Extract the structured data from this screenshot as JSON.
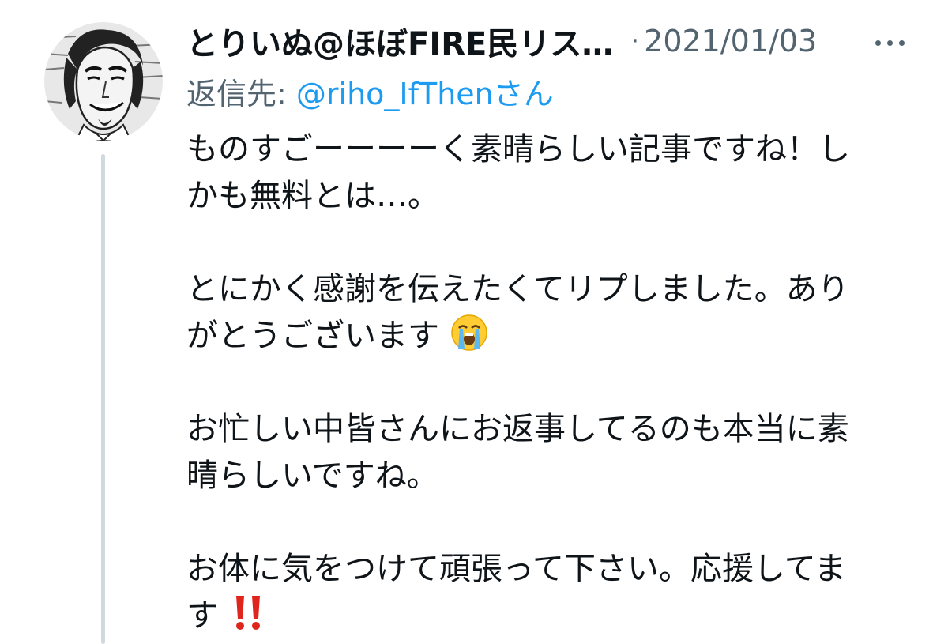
{
  "tweet": {
    "display_name": "とりいぬ@ほぼFIRE民リス…",
    "separator": "·",
    "timestamp": "2021/01/03",
    "reply_prefix": "返信先: ",
    "reply_handle": "@riho_IfThen",
    "reply_suffix": "さん",
    "paragraphs": [
      [
        "ものすごーーーーく素晴らしい記事ですね！し",
        "かも無料とは…。"
      ],
      [
        "とにかく感謝を伝えたくてリプしました。あり",
        "がとうございます"
      ],
      [
        "お忙しい中皆さんにお返事してるのも本当に素",
        "晴らしいですね。"
      ],
      [
        "お体に気をつけて頑張って下さい。応援してま",
        "す"
      ]
    ],
    "emojis": {
      "crying": "loudly-crying-face-emoji",
      "exclamation": "double-exclamation-emoji"
    },
    "colors": {
      "link": "#1d9bf0",
      "secondary": "#536471",
      "thread_line": "#cfd9de",
      "exclamation_red": "#e0261c"
    }
  }
}
